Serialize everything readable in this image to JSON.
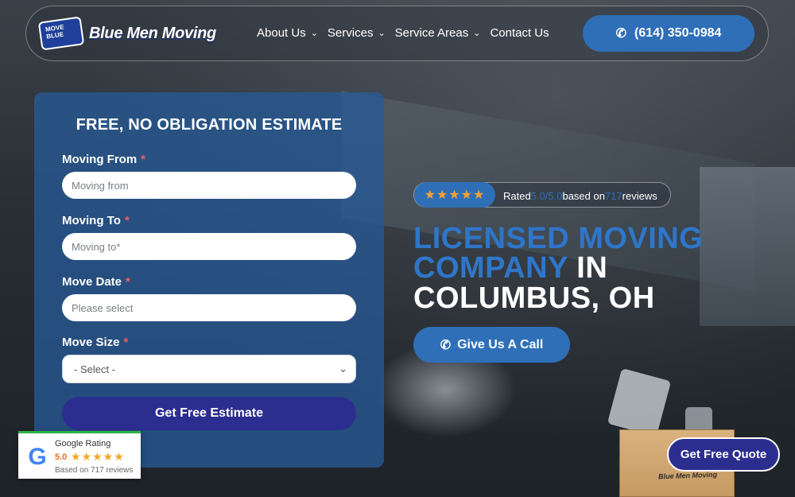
{
  "header": {
    "logo_badge": "MOVE BLUE",
    "logo_text": "Blue Men Moving",
    "nav": [
      {
        "label": "About Us",
        "has_dropdown": true
      },
      {
        "label": "Services",
        "has_dropdown": true
      },
      {
        "label": "Service Areas",
        "has_dropdown": true
      },
      {
        "label": "Contact Us",
        "has_dropdown": false
      }
    ],
    "phone": "(614) 350-0984"
  },
  "form": {
    "title": "FREE, NO OBLIGATION ESTIMATE",
    "required_mark": "*",
    "fields": [
      {
        "label": "Moving From",
        "placeholder": "Moving from"
      },
      {
        "label": "Moving To",
        "placeholder": "Moving to*"
      },
      {
        "label": "Move Date",
        "placeholder": "Please select"
      },
      {
        "label": "Move Size",
        "selected": "- Select -"
      }
    ],
    "submit": "Get Free Estimate"
  },
  "google_badge": {
    "logo": "G",
    "title": "Google Rating",
    "score": "5.0",
    "stars": "★★★★★",
    "based": "Based on 717 reviews"
  },
  "hero": {
    "rating": {
      "stars": "★★★★★",
      "prefix": "Rated",
      "score": "5.0/5.0",
      "middle": "based on",
      "count": "717",
      "suffix": "reviews"
    },
    "line1": "LICENSED MOVING",
    "line2_blue": "COMPANY",
    "line2_white": "IN",
    "line3": "COLUMBUS, OH",
    "call_button": "Give Us A Call"
  },
  "box_label": "Blue Men Moving",
  "quote_button": "Get Free Quote",
  "colors": {
    "primary_blue": "#2f6fb8",
    "accent_blue": "#2e76c9",
    "dark_button": "#2c2e8f",
    "star": "#f7a130"
  }
}
